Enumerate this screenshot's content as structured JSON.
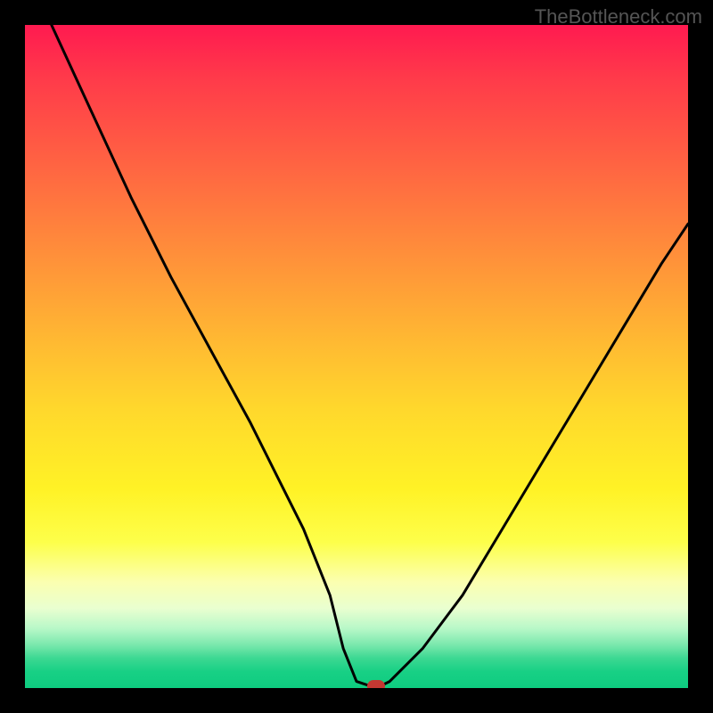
{
  "attribution": "TheBottleneck.com",
  "chart_data": {
    "type": "line",
    "title": "",
    "xlabel": "",
    "ylabel": "",
    "xlim": [
      0,
      100
    ],
    "ylim": [
      0,
      100
    ],
    "grid": false,
    "series": [
      {
        "name": "bottleneck-curve",
        "x": [
          4,
          10,
          16,
          22,
          28,
          34,
          38,
          42,
          46,
          48,
          50,
          53,
          55,
          60,
          66,
          72,
          78,
          84,
          90,
          96,
          100
        ],
        "values": [
          100,
          87,
          74,
          62,
          51,
          40,
          32,
          24,
          14,
          6,
          1,
          0,
          1,
          6,
          14,
          24,
          34,
          44,
          54,
          64,
          70
        ]
      }
    ],
    "marker": {
      "x": 53,
      "y": 0
    },
    "background": {
      "stops": [
        {
          "pos": 0,
          "color": "#ff1a50"
        },
        {
          "pos": 0.5,
          "color": "#ffba32"
        },
        {
          "pos": 0.78,
          "color": "#fdff4a"
        },
        {
          "pos": 1.0,
          "color": "#0ecc80"
        }
      ]
    }
  }
}
